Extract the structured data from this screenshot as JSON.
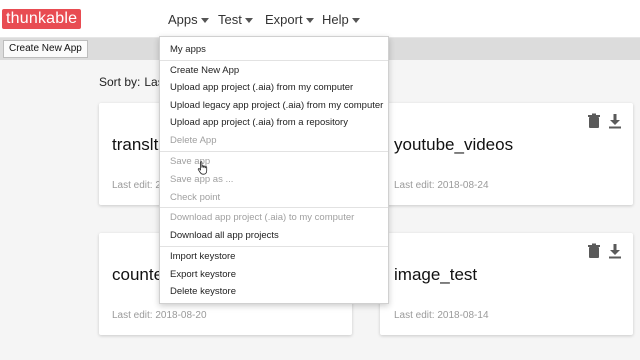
{
  "header": {
    "logo_text": "thunkable",
    "menus": [
      {
        "label": "Apps"
      },
      {
        "label": "Test"
      },
      {
        "label": "Export"
      },
      {
        "label": "Help"
      }
    ]
  },
  "toolbar": {
    "create_label": "Create New App"
  },
  "sort": {
    "label": "Sort by:",
    "value": "Las"
  },
  "cards": [
    {
      "title": "translt",
      "date": "Last edit: 20"
    },
    {
      "title": "youtube_videos",
      "date": "Last edit: 2018-08-24"
    },
    {
      "title": "counte",
      "date": "Last edit: 2018-08-20"
    },
    {
      "title": "image_test",
      "date": "Last edit: 2018-08-14"
    }
  ],
  "apps_menu": {
    "items": [
      {
        "label": "My apps",
        "enabled": true
      },
      {
        "label": "Create New App",
        "enabled": true
      },
      {
        "label": "Upload app project (.aia) from my computer",
        "enabled": true
      },
      {
        "label": "Upload legacy app project (.aia) from my computer",
        "enabled": true
      },
      {
        "label": "Upload app project (.aia) from a repository",
        "enabled": true
      },
      {
        "label": "Delete App",
        "enabled": false
      },
      {
        "label": "Save app",
        "enabled": false
      },
      {
        "label": "Save app as ...",
        "enabled": false
      },
      {
        "label": "Check point",
        "enabled": false
      },
      {
        "label": "Download app project (.aia) to my computer",
        "enabled": false
      },
      {
        "label": "Download all app projects",
        "enabled": true
      },
      {
        "label": "Import keystore",
        "enabled": true
      },
      {
        "label": "Export keystore",
        "enabled": true
      },
      {
        "label": "Delete keystore",
        "enabled": true
      }
    ]
  },
  "colors": {
    "brand": "#e84c52",
    "disabled_text": "#a0a0a0",
    "toolbar_bg": "#dcdcdc"
  },
  "icons": {
    "delete": "trash-icon",
    "download": "download-icon"
  }
}
